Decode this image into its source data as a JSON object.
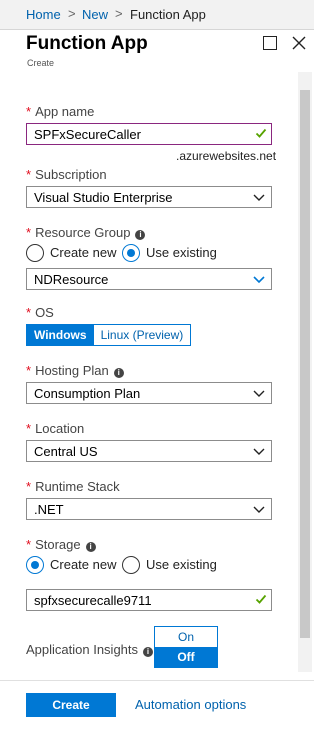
{
  "breadcrumb": {
    "items": [
      "Home",
      "New",
      "Function App"
    ],
    "separator": ">"
  },
  "blade": {
    "title": "Function App",
    "subtitle": "Create"
  },
  "form": {
    "app_name": {
      "label": "App name",
      "value": "SPFxSecureCaller",
      "suffix": ".azurewebsites.net",
      "valid": true
    },
    "subscription": {
      "label": "Subscription",
      "value": "Visual Studio Enterprise"
    },
    "resource_group": {
      "label": "Resource Group",
      "options": [
        "Create new",
        "Use existing"
      ],
      "selected": "Use existing",
      "value": "NDResource"
    },
    "os": {
      "label": "OS",
      "options": [
        "Windows",
        "Linux (Preview)"
      ],
      "selected": "Windows"
    },
    "hosting_plan": {
      "label": "Hosting Plan",
      "value": "Consumption Plan"
    },
    "location": {
      "label": "Location",
      "value": "Central US"
    },
    "runtime_stack": {
      "label": "Runtime Stack",
      "value": ".NET"
    },
    "storage": {
      "label": "Storage",
      "options": [
        "Create new",
        "Use existing"
      ],
      "selected": "Create new",
      "value": "spfxsecurecalle9711",
      "valid": true
    },
    "app_insights": {
      "label": "Application Insights",
      "options": [
        "On",
        "Off"
      ],
      "selected": "Off"
    }
  },
  "footer": {
    "create_label": "Create",
    "automation_label": "Automation options"
  },
  "colors": {
    "accent": "#0078d4",
    "link": "#0062ad",
    "required": "#e00b1c",
    "valid_check": "#57a300",
    "focus_border": "#8a277f"
  },
  "icons": [
    "maximize-icon",
    "close-icon",
    "info-icon",
    "chevron-down-icon",
    "checkmark-icon"
  ]
}
